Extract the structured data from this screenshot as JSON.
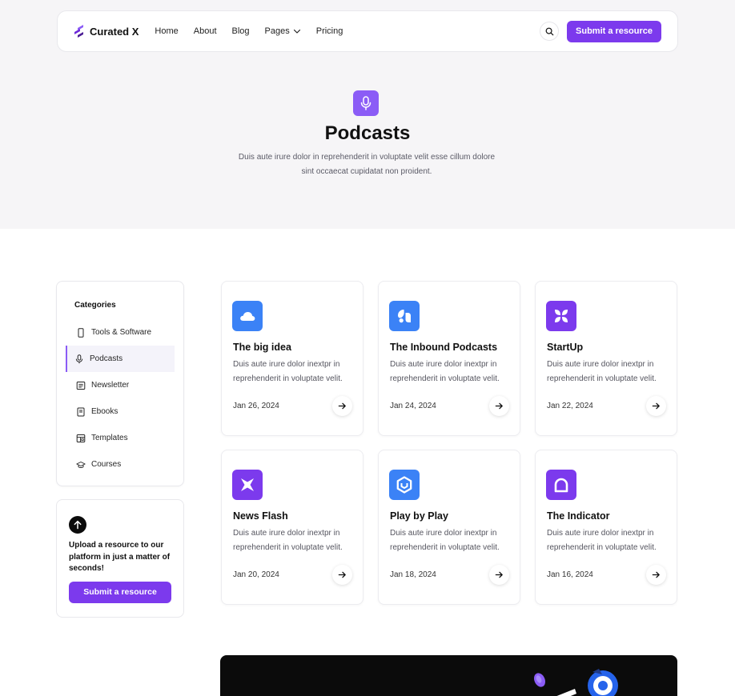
{
  "nav": {
    "brand": "Curated X",
    "links": [
      "Home",
      "About",
      "Blog",
      "Pages",
      "Pricing"
    ],
    "cta": "Submit a resource"
  },
  "hero": {
    "title": "Podcasts",
    "description": "Duis aute irure dolor in reprehenderit in voluptate velit esse cillum dolore sint occaecat cupidatat non proident."
  },
  "sidebar": {
    "title": "Categories",
    "items": [
      {
        "label": "Tools & Software",
        "icon": "phone-icon",
        "active": false
      },
      {
        "label": "Podcasts",
        "icon": "microphone-icon",
        "active": true
      },
      {
        "label": "Newsletter",
        "icon": "newsletter-icon",
        "active": false
      },
      {
        "label": "Ebooks",
        "icon": "book-icon",
        "active": false
      },
      {
        "label": "Templates",
        "icon": "template-icon",
        "active": false
      },
      {
        "label": "Courses",
        "icon": "graduation-cap-icon",
        "active": false
      }
    ]
  },
  "upload": {
    "text": "Upload a resource to our platform in just a matter of seconds!",
    "button": "Submit a resource"
  },
  "cards": [
    {
      "title": "The big idea",
      "description": "Duis aute irure dolor inextpr in reprehenderit in voluptate velit.",
      "date": "Jan 26, 2024",
      "logo": "cloud-logo",
      "color": "#3b82f6"
    },
    {
      "title": "The Inbound Podcasts",
      "description": "Duis aute irure dolor inextpr in reprehenderit in voluptate velit.",
      "date": "Jan 24, 2024",
      "logo": "bubbles-logo",
      "color": "#3b82f6"
    },
    {
      "title": "StartUp",
      "description": "Duis aute irure dolor inextpr in reprehenderit in voluptate velit.",
      "date": "Jan 22, 2024",
      "logo": "petals-logo",
      "color": "#7c3aed"
    },
    {
      "title": "News Flash",
      "description": "Duis aute irure dolor inextpr in reprehenderit in voluptate velit.",
      "date": "Jan 20, 2024",
      "logo": "x-logo",
      "color": "#7c3aed"
    },
    {
      "title": "Play by Play",
      "description": "Duis aute irure dolor inextpr in reprehenderit in voluptate velit.",
      "date": "Jan 18, 2024",
      "logo": "hexagon-logo",
      "color": "#3b82f6"
    },
    {
      "title": "The Indicator",
      "description": "Duis aute irure dolor inextpr in reprehenderit in voluptate velit.",
      "date": "Jan 16, 2024",
      "logo": "arch-logo",
      "color": "#7c3aed"
    }
  ],
  "colors": {
    "accent": "#7c3aed",
    "hero_bg": "#f6f5f7",
    "blue": "#3b82f6"
  }
}
